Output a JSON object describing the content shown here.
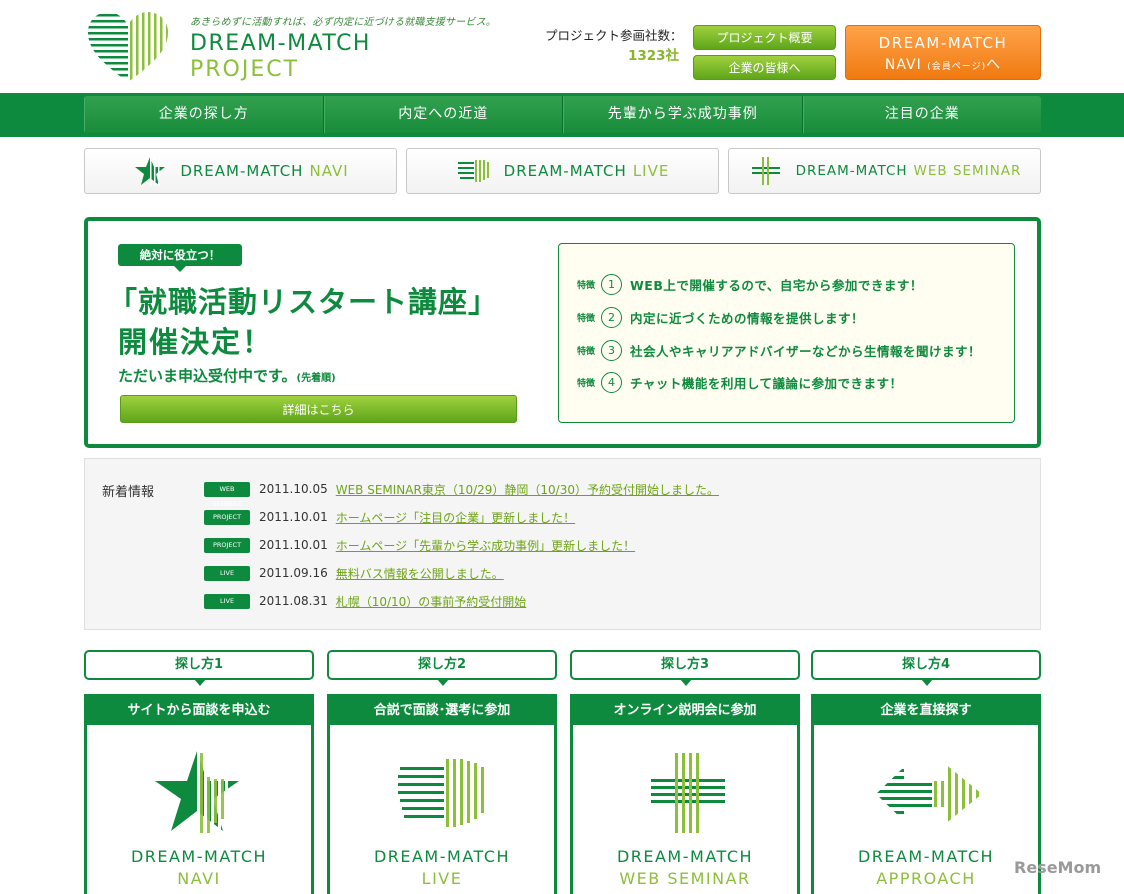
{
  "header": {
    "tagline": "あきらめずに活動すれば、必ず内定に近づける就職支援サービス。",
    "logo_line1": "DREAM-MATCH",
    "logo_line2": "PROJECT",
    "count_label": "プロジェクト参画社数：",
    "count_value": "1323社",
    "btn_overview": "プロジェクト概要",
    "btn_companies": "企業の皆様へ",
    "navi_line1": "DREAM-MATCH",
    "navi_line2": "NAVI",
    "navi_small": "(会員ページ)",
    "navi_suffix": "へ"
  },
  "nav": {
    "items": [
      {
        "label": "企業の探し方"
      },
      {
        "label": "内定への近道"
      },
      {
        "label": "先輩から学ぶ成功事例"
      },
      {
        "label": "注目の企業"
      }
    ]
  },
  "services": [
    {
      "part1": "DREAM-MATCH",
      "part2": "NAVI",
      "icon": "star-icon"
    },
    {
      "part1": "DREAM-MATCH",
      "part2": "LIVE",
      "icon": "heart-icon"
    },
    {
      "part1": "DREAM-MATCH",
      "part2": "WEB SEMINAR",
      "icon": "plus-icon"
    }
  ],
  "hero": {
    "badge": "絶対に役立つ！",
    "title1": "「就職活動リスタート講座」",
    "title2": "開催決定！",
    "sub": "ただいま申込受付中です。",
    "sub_small": "(先着順)",
    "detail_button": "詳細はこちら",
    "feature_token": "特徴",
    "features": [
      {
        "num": "1",
        "text": "WEB上で開催するので、自宅から参加できます！"
      },
      {
        "num": "2",
        "text": "内定に近づくための情報を提供します！"
      },
      {
        "num": "3",
        "text": "社会人やキャリアアドバイザーなどから生情報を聞けます！"
      },
      {
        "num": "4",
        "text": "チャット機能を利用して議論に参加できます！"
      }
    ]
  },
  "news": {
    "label": "新着情報",
    "items": [
      {
        "tag": "WEB SEMINAR",
        "date": "2011.10.05",
        "text": "WEB SEMINAR東京（10/29）静岡（10/30）予約受付開始しました。"
      },
      {
        "tag": "PROJECT",
        "date": "2011.10.01",
        "text": "ホームページ「注目の企業」更新しました！"
      },
      {
        "tag": "PROJECT",
        "date": "2011.10.01",
        "text": "ホームページ「先輩から学ぶ成功事例」更新しました！"
      },
      {
        "tag": "LIVE",
        "date": "2011.09.16",
        "text": "無料バス情報を公開しました。"
      },
      {
        "tag": "LIVE",
        "date": "2011.08.31",
        "text": "札幌（10/10）の事前予約受付開始"
      }
    ]
  },
  "steps": [
    {
      "step": "探し方1",
      "head": "サイトから面談を申込む",
      "name1": "DREAM-MATCH",
      "name2": "NAVI"
    },
    {
      "step": "探し方2",
      "head": "合説で面談･選考に参加",
      "name1": "DREAM-MATCH",
      "name2": "LIVE"
    },
    {
      "step": "探し方3",
      "head": "オンライン説明会に参加",
      "name1": "DREAM-MATCH",
      "name2": "WEB SEMINAR"
    },
    {
      "step": "探し方4",
      "head": "企業を直接探す",
      "name1": "DREAM-MATCH",
      "name2": "APPROACH"
    }
  ],
  "watermark": "ReseMom"
}
